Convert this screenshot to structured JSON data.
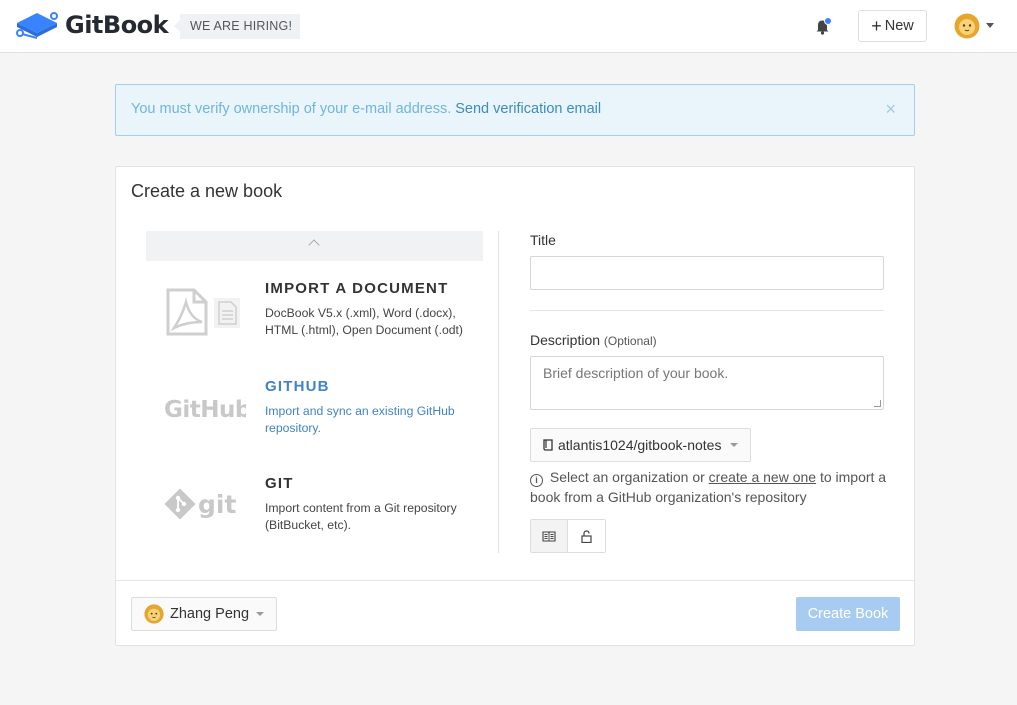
{
  "header": {
    "brand": "GitBook",
    "hiring_badge": "WE ARE HIRING!",
    "new_button_label": "New"
  },
  "alert": {
    "message": "You must verify ownership of your e-mail address.",
    "link_label": "Send verification email",
    "close_glyph": "×",
    "color": "#e9f5fb"
  },
  "card": {
    "title": "Create a new book"
  },
  "sources": [
    {
      "title": "IMPORT A DOCUMENT",
      "description": "DocBook V5.x (.xml), Word (.docx), HTML (.html), Open Document (.odt)",
      "icon": "pdf-document-icon",
      "active": false
    },
    {
      "title": "GITHUB",
      "description": "Import and sync an existing GitHub repository.",
      "icon": "github-icon",
      "active": true
    },
    {
      "title": "GIT",
      "description": "Import content from a Git repository (BitBucket, etc).",
      "icon": "git-icon",
      "active": false
    }
  ],
  "form": {
    "title_label": "Title",
    "title_value": "",
    "description_label": "Description",
    "description_optional": "(Optional)",
    "description_placeholder": "Brief description of your book.",
    "repository_selected": "atlantis1024/gitbook-notes",
    "help_text_before": "Select an organization or",
    "help_link": "create a new one",
    "help_text_after": "to import a book from a GitHub organization's repository"
  },
  "footer": {
    "owner_name": "Zhang Peng",
    "create_button_label": "Create Book"
  },
  "colors": {
    "accent": "#4183c4",
    "create_button": "#a8cbf2"
  }
}
